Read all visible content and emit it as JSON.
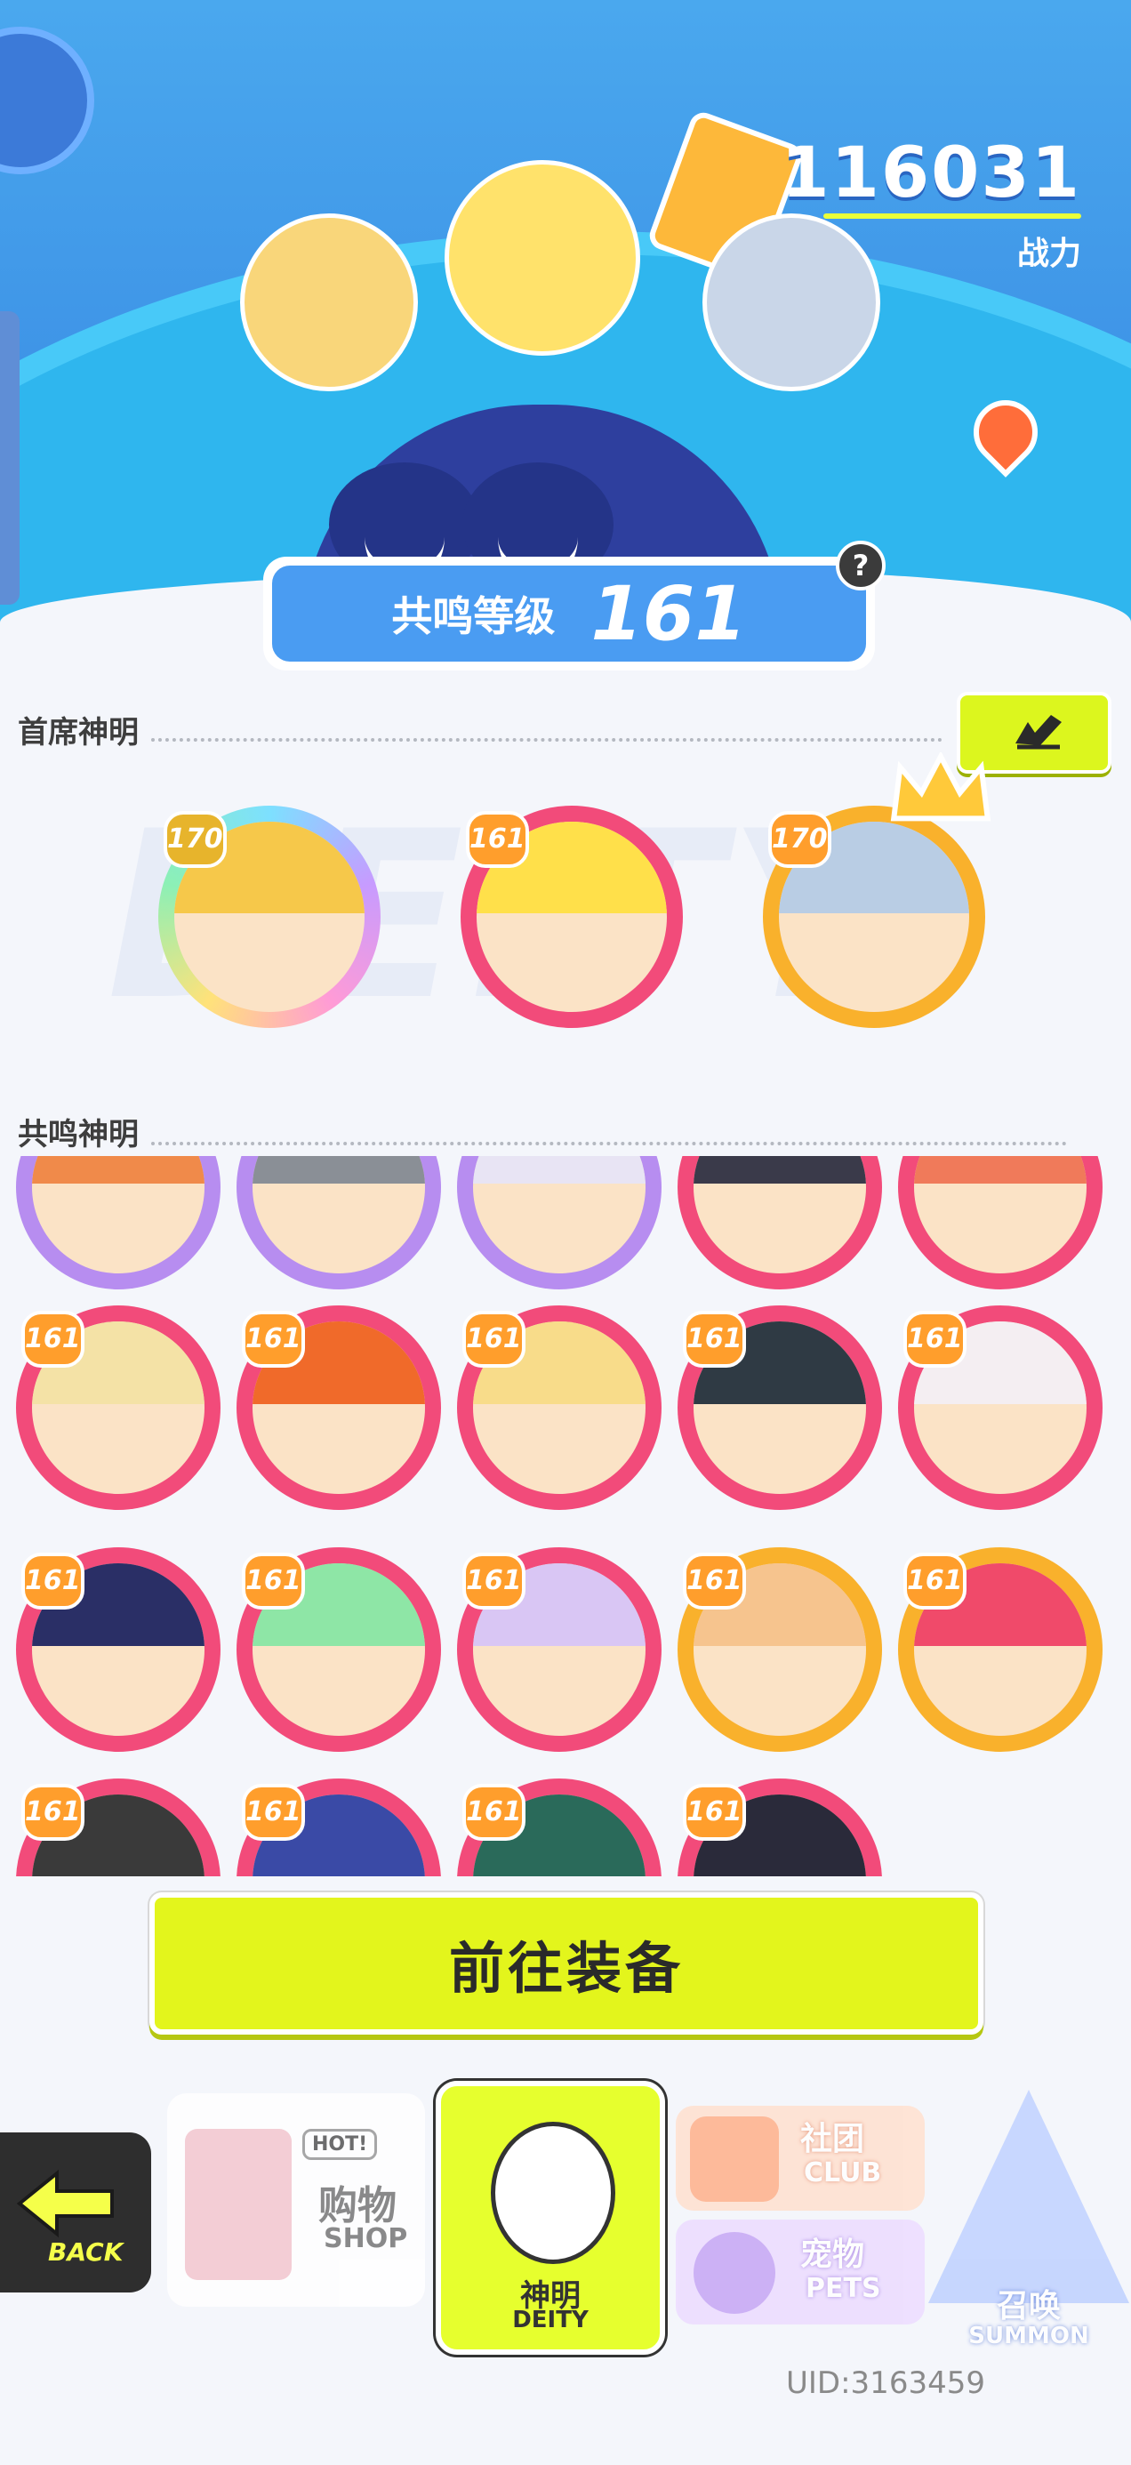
{
  "header": {
    "combat_power_value": "116031",
    "combat_power_label": "战力",
    "resonance_label": "共鸣等级",
    "resonance_level": "161",
    "help_symbol": "?"
  },
  "sections": {
    "chief_title": "首席神明",
    "resonance_title": "共鸣神明"
  },
  "chief_deities": [
    {
      "level": "170",
      "frame": "rainbow",
      "hair": "#f6c84a",
      "crown": false
    },
    {
      "level": "161",
      "frame": "pink",
      "hair": "#ffe04a",
      "crown": false
    },
    {
      "level": "170",
      "frame": "gold",
      "hair": "#b9cde4",
      "crown": true
    }
  ],
  "resonance_deities": [
    {
      "level": "",
      "frame": "purple",
      "hair": "#f08a4a"
    },
    {
      "level": "",
      "frame": "purple",
      "hair": "#8a8f96"
    },
    {
      "level": "",
      "frame": "purple",
      "hair": "#e8e4f4"
    },
    {
      "level": "",
      "frame": "pink",
      "hair": "#3a3a4a"
    },
    {
      "level": "",
      "frame": "pink",
      "hair": "#f07a5a"
    },
    {
      "level": "161",
      "frame": "pink",
      "hair": "#f4e2a6"
    },
    {
      "level": "161",
      "frame": "pink",
      "hair": "#f06a2a"
    },
    {
      "level": "161",
      "frame": "pink",
      "hair": "#f8dc8a"
    },
    {
      "level": "161",
      "frame": "pink",
      "hair": "#2f3a44"
    },
    {
      "level": "161",
      "frame": "pink",
      "hair": "#f4eef2"
    },
    {
      "level": "161",
      "frame": "pink",
      "hair": "#2a2f66"
    },
    {
      "level": "161",
      "frame": "pink",
      "hair": "#8ee6a6"
    },
    {
      "level": "161",
      "frame": "pink",
      "hair": "#d9c6f4"
    },
    {
      "level": "161",
      "frame": "gold",
      "hair": "#f6c48e"
    },
    {
      "level": "161",
      "frame": "gold",
      "hair": "#f04a6a"
    },
    {
      "level": "161",
      "frame": "pink",
      "hair": "#3a3a3a"
    },
    {
      "level": "161",
      "frame": "pink",
      "hair": "#3a4aa6"
    },
    {
      "level": "161",
      "frame": "pink",
      "hair": "#2a6a5a"
    },
    {
      "level": "161",
      "frame": "pink",
      "hair": "#2a2a3a"
    }
  ],
  "buttons": {
    "equip_label": "前往装备"
  },
  "nav": {
    "back_label": "BACK",
    "shop_hot": "HOT!",
    "shop_cn": "购物",
    "shop_en": "SHOP",
    "deity_cn": "神明",
    "deity_en": "DEITY",
    "club_cn": "社团",
    "club_en": "CLUB",
    "pets_cn": "宠物",
    "pets_en": "PETS",
    "summon_cn": "召唤",
    "summon_en": "SUMMON"
  },
  "footer": {
    "uid": "UID:3163459"
  },
  "icons": {
    "edit": "pencil-icon",
    "back": "back-arrow-icon",
    "location": "location-pin-icon",
    "crown": "crown-icon"
  },
  "colors": {
    "accent_lime": "#e3f51c",
    "header_blue": "#3d92e6",
    "frame_pink": "#f24b7a",
    "frame_gold": "#f9b12c"
  }
}
